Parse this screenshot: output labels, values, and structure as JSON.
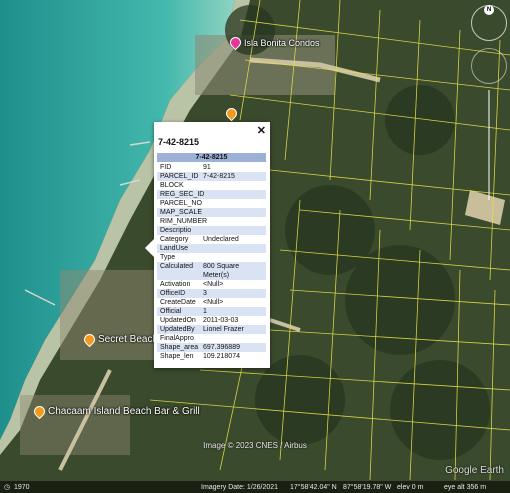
{
  "map": {
    "places": [
      {
        "name": "Secret Beach Wa",
        "type": "orange"
      },
      {
        "name": "Chacaam Island Beach Bar & Grill",
        "type": "orange"
      },
      {
        "name": "Isla Bonita Condos",
        "type": "pink"
      },
      {
        "name": "",
        "type": "orange"
      }
    ],
    "credit": "Image © 2023 CNES / Airbus",
    "logo": "Google Earth",
    "compass_label": "N"
  },
  "status": {
    "left_icon": "1970",
    "imagery_date": "Imagery Date: 1/26/2021",
    "lat": "17°58'42.04\" N",
    "lon": "87°58'19.78\" W",
    "elev": "elev   0 m",
    "eye_alt": "eye alt   356 m"
  },
  "popup": {
    "title": "7-42-8215",
    "header": "7-42-8215",
    "close": "✕",
    "rows": [
      {
        "k": "FID",
        "v": "91"
      },
      {
        "k": "PARCEL_ID",
        "v": "7-42-8215"
      },
      {
        "k": "BLOCK",
        "v": ""
      },
      {
        "k": "REG_SEC_ID",
        "v": ""
      },
      {
        "k": "PARCEL_NO",
        "v": ""
      },
      {
        "k": "MAP_SCALE",
        "v": ""
      },
      {
        "k": "RIM_NUMBER",
        "v": ""
      },
      {
        "k": "Descriptio",
        "v": ""
      },
      {
        "k": "Category",
        "v": "Undeclared"
      },
      {
        "k": "LandUse",
        "v": ""
      },
      {
        "k": "Type",
        "v": ""
      },
      {
        "k": "Calculated",
        "v": "800 Square Meter(s)"
      },
      {
        "k": "Activation",
        "v": "<Null>"
      },
      {
        "k": "OfficeID",
        "v": "3"
      },
      {
        "k": "CreateDate",
        "v": "<Null>"
      },
      {
        "k": "Official",
        "v": "1"
      },
      {
        "k": "UpdatedOn",
        "v": "2011-03-03"
      },
      {
        "k": "UpdatedBy",
        "v": "Lionel Frazer"
      },
      {
        "k": "FinalAppro",
        "v": ""
      },
      {
        "k": "Shape_area",
        "v": "697.396889"
      },
      {
        "k": "Shape_len",
        "v": "109.218074"
      }
    ]
  }
}
